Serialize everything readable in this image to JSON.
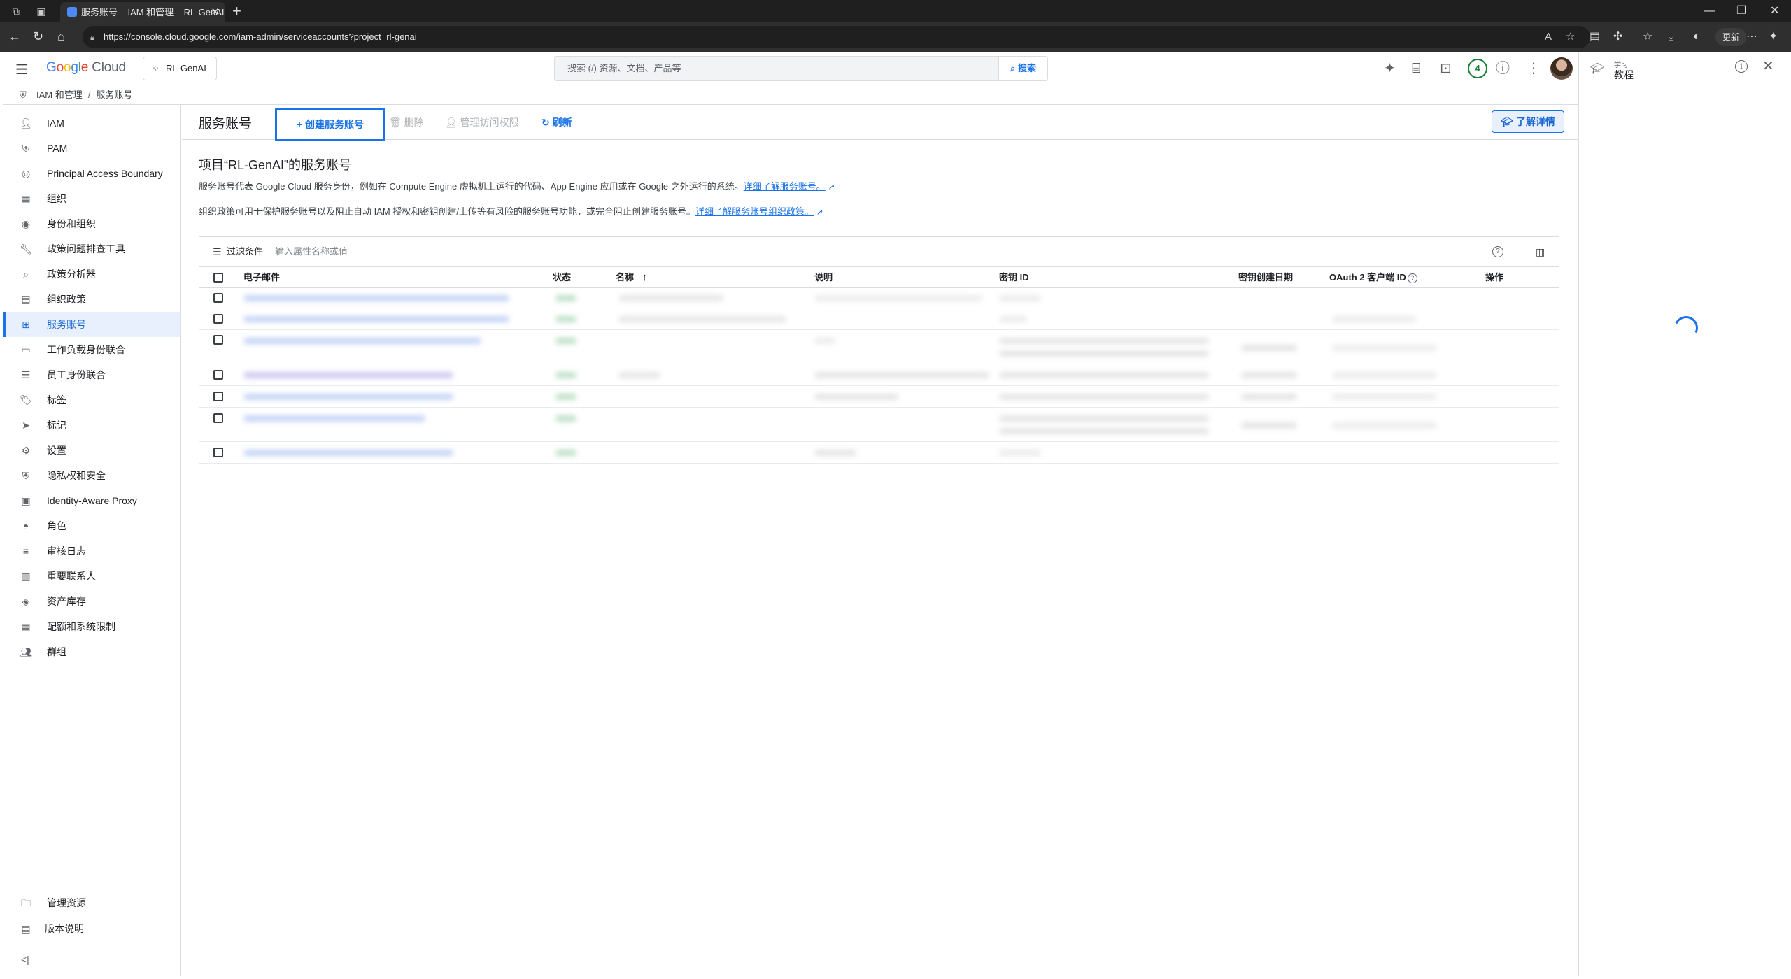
{
  "browser": {
    "tab_title": "服务账号 – IAM 和管理 – RL-GenAI",
    "url": "https://console.cloud.google.com/iam-admin/serviceaccounts?project=rl-genai",
    "update_label": "更新"
  },
  "header": {
    "logo": {
      "g": "G",
      "o1": "o",
      "o2": "o",
      "g2": "g",
      "l": "l",
      "e": "e",
      "cloud": "Cloud"
    },
    "project": "RL-GenAI",
    "search_placeholder": "搜索 (/) 资源、文档、产品等",
    "search_button": "搜索",
    "notification_count": "4"
  },
  "breadcrumb": {
    "parent": "IAM 和管理",
    "current": "服务账号"
  },
  "sidebar": {
    "items": [
      {
        "label": "IAM",
        "icon": "person-add-icon"
      },
      {
        "label": "PAM",
        "icon": "shield-icon"
      },
      {
        "label": "Principal Access Boundary",
        "icon": "boundary-icon"
      },
      {
        "label": "组织",
        "icon": "building-icon"
      },
      {
        "label": "身份和组织",
        "icon": "account-circle-icon"
      },
      {
        "label": "政策问题排查工具",
        "icon": "wrench-icon"
      },
      {
        "label": "政策分析器",
        "icon": "analyzer-icon"
      },
      {
        "label": "组织政策",
        "icon": "policy-icon"
      },
      {
        "label": "服务账号",
        "icon": "service-account-icon",
        "active": true
      },
      {
        "label": "工作负载身份联合",
        "icon": "id-card-icon"
      },
      {
        "label": "员工身份联合",
        "icon": "list-icon"
      },
      {
        "label": "标签",
        "icon": "tag-icon"
      },
      {
        "label": "标记",
        "icon": "label-icon"
      },
      {
        "label": "设置",
        "icon": "gear-icon"
      },
      {
        "label": "隐私权和安全",
        "icon": "privacy-shield-icon"
      },
      {
        "label": "Identity-Aware Proxy",
        "icon": "proxy-icon"
      },
      {
        "label": "角色",
        "icon": "role-icon"
      },
      {
        "label": "审核日志",
        "icon": "log-icon"
      },
      {
        "label": "重要联系人",
        "icon": "contacts-icon"
      },
      {
        "label": "资产库存",
        "icon": "inventory-icon"
      },
      {
        "label": "配额和系统限制",
        "icon": "quota-icon"
      },
      {
        "label": "群组",
        "icon": "group-icon"
      }
    ],
    "bottom": [
      {
        "label": "管理资源",
        "icon": "folder-gear-icon"
      },
      {
        "label": "版本说明",
        "icon": "notes-icon"
      }
    ]
  },
  "toolbar": {
    "title": "服务账号",
    "create": "创建服务账号",
    "delete": "删除",
    "manage_access": "管理访问权限",
    "refresh": "刷新",
    "learn_more": "了解详情"
  },
  "content": {
    "section_title": "项目“RL-GenAI”的服务账号",
    "desc1": "服务账号代表 Google Cloud 服务身份，例如在 Compute Engine 虚拟机上运行的代码、App Engine 应用或在 Google 之外运行的系统。",
    "desc1_link": "详细了解服务账号。",
    "desc2": "组织政策可用于保护服务账号以及阻止自动 IAM 授权和密钥创建/上传等有风险的服务账号功能，或完全阻止创建服务账号。",
    "desc2_link": "详细了解服务账号组织政策。",
    "filter_label": "过滤条件",
    "filter_placeholder": "输入属性名称或值"
  },
  "table": {
    "columns": {
      "email": "电子邮件",
      "status": "状态",
      "name": "名称",
      "description": "说明",
      "key_id": "密钥 ID",
      "key_date": "密钥创建日期",
      "oauth": "OAuth 2 客户端 ID",
      "actions": "操作"
    },
    "sort_indicator": "↑"
  },
  "right_panel": {
    "small": "学习",
    "title": "教程"
  },
  "colors": {
    "accent": "#1a73e8",
    "active_bg": "#e8f0fe"
  }
}
